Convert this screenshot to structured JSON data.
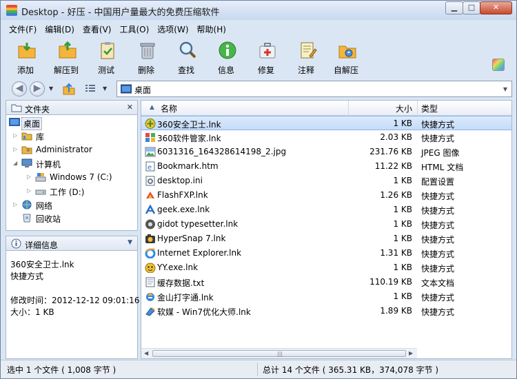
{
  "window": {
    "title": "Desktop - 好压 - 中国用户量最大的免费压缩软件"
  },
  "menu": [
    "文件(F)",
    "编辑(D)",
    "查看(V)",
    "工具(O)",
    "选项(W)",
    "帮助(H)"
  ],
  "toolbar": [
    {
      "label": "添加",
      "icon": "add-folder-icon"
    },
    {
      "label": "解压到",
      "icon": "extract-folder-icon"
    },
    {
      "label": "测试",
      "icon": "test-clipboard-icon"
    },
    {
      "label": "删除",
      "icon": "trash-can-icon"
    },
    {
      "label": "查找",
      "icon": "magnifier-icon"
    },
    {
      "label": "信息",
      "icon": "info-icon"
    },
    {
      "label": "修复",
      "icon": "first-aid-kit-icon"
    },
    {
      "label": "注释",
      "icon": "notepad-icon"
    },
    {
      "label": "自解压",
      "icon": "self-extract-folder-icon"
    }
  ],
  "address": {
    "value": "桌面"
  },
  "folders": {
    "title": "文件夹",
    "items": [
      "桌面",
      "库",
      "Administrator",
      "计算机",
      "Windows 7 (C:)",
      "工作 (D:)",
      "网络",
      "回收站"
    ]
  },
  "details": {
    "title": "详细信息",
    "name": "360安全卫士.lnk",
    "type": "快捷方式",
    "modified": "修改时间：2012-12-12 09:01:16",
    "size": "大小：1 KB"
  },
  "columns": {
    "name": "名称",
    "size": "大小",
    "type": "类型"
  },
  "files": [
    {
      "name": "360安全卫士.lnk",
      "size": "1 KB",
      "type": "快捷方式",
      "selected": true
    },
    {
      "name": "360软件管家.lnk",
      "size": "2.03 KB",
      "type": "快捷方式"
    },
    {
      "name": "6031316_164328614198_2.jpg",
      "size": "231.76 KB",
      "type": "JPEG 图像"
    },
    {
      "name": "Bookmark.htm",
      "size": "11.22 KB",
      "type": "HTML 文档"
    },
    {
      "name": "desktop.ini",
      "size": "1 KB",
      "type": "配置设置"
    },
    {
      "name": "FlashFXP.lnk",
      "size": "1.26 KB",
      "type": "快捷方式"
    },
    {
      "name": "geek.exe.lnk",
      "size": "1 KB",
      "type": "快捷方式"
    },
    {
      "name": "gidot typesetter.lnk",
      "size": "1 KB",
      "type": "快捷方式"
    },
    {
      "name": "HyperSnap 7.lnk",
      "size": "1 KB",
      "type": "快捷方式"
    },
    {
      "name": "Internet Explorer.lnk",
      "size": "1.31 KB",
      "type": "快捷方式"
    },
    {
      "name": "YY.exe.lnk",
      "size": "1 KB",
      "type": "快捷方式"
    },
    {
      "name": "缓存数据.txt",
      "size": "110.19 KB",
      "type": "文本文档"
    },
    {
      "name": "金山打字通.lnk",
      "size": "1 KB",
      "type": "快捷方式"
    },
    {
      "name": "软媒 - Win7优化大师.lnk",
      "size": "1.89 KB",
      "type": "快捷方式"
    }
  ],
  "status": {
    "left": "选中 1 个文件 ( 1,008 字节 )",
    "right": "总计 14 个文件 ( 365.31 KB，374,078 字节 )"
  }
}
